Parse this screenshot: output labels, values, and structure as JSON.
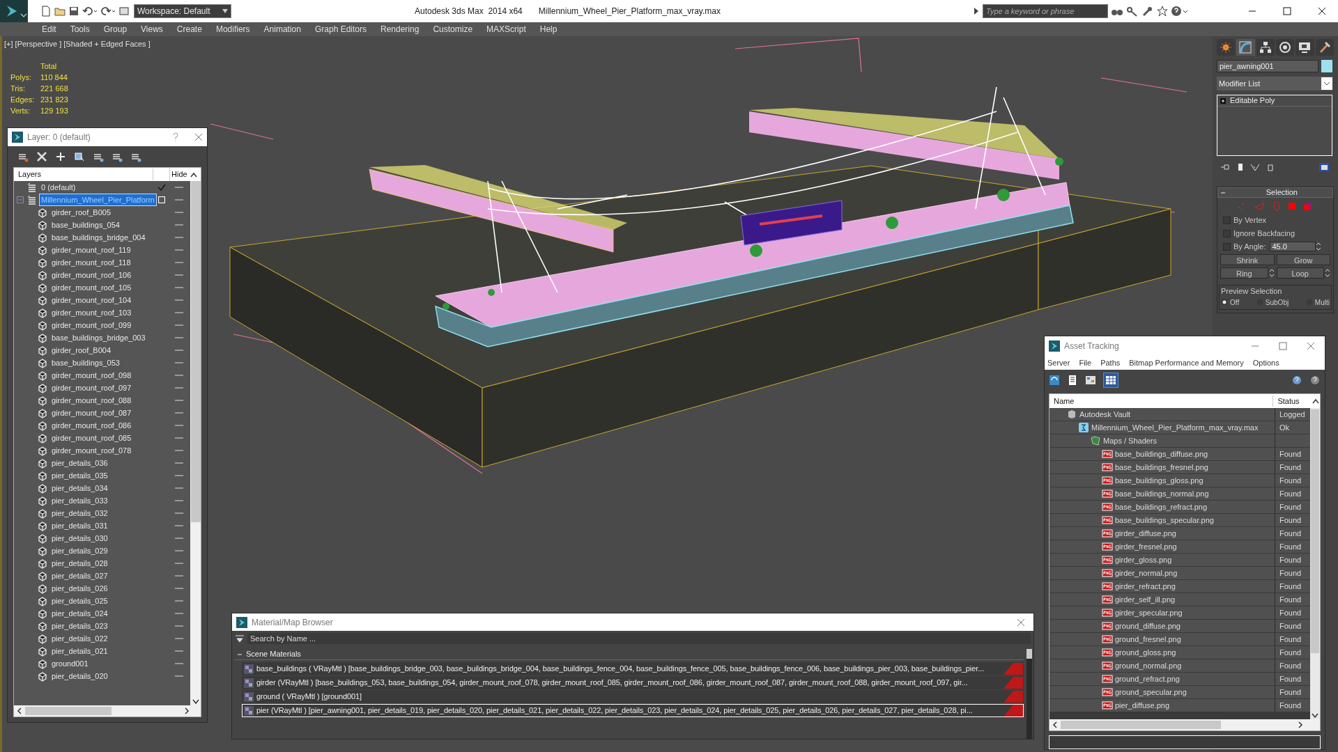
{
  "title_bar": {
    "workspace": "Workspace: Default",
    "app_title": "Autodesk 3ds Max  2014 x64",
    "file_name": "Millennium_Wheel_Pier_Platform_max_vray.max",
    "search": {
      "placeholder": "Type a keyword or phrase"
    }
  },
  "menu": [
    "Edit",
    "Tools",
    "Group",
    "Views",
    "Create",
    "Modifiers",
    "Animation",
    "Graph Editors",
    "Rendering",
    "Customize",
    "MAXScript",
    "Help"
  ],
  "viewport": {
    "label": "[+] [Perspective ] [Shaded + Edged Faces ]",
    "stats": {
      "header": "Total",
      "rows": [
        {
          "label": "Polys:",
          "value": "110 844"
        },
        {
          "label": "Tris:",
          "value": "221 668"
        },
        {
          "label": "Edges:",
          "value": "231 823"
        },
        {
          "label": "Verts:",
          "value": "129 193"
        }
      ]
    }
  },
  "layer_window": {
    "title": "Layer: 0 (default)",
    "columns": [
      "Layers",
      "Hide"
    ],
    "layers": [
      {
        "name": "0 (default)",
        "current": true,
        "selected": false
      },
      {
        "name": "Millennium_Wheel_Pier_Platform",
        "current": false,
        "selected": true,
        "expanded": true,
        "children": [
          {
            "name": "girder_roof_B005",
            "selected": false
          },
          {
            "name": "base_buildings_054",
            "selected": false
          },
          {
            "name": "base_buildings_bridge_004",
            "selected": false
          },
          {
            "name": "girder_mount_roof_119",
            "selected": false
          },
          {
            "name": "girder_mount_roof_118",
            "selected": false
          },
          {
            "name": "girder_mount_roof_106",
            "selected": false
          },
          {
            "name": "girder_mount_roof_105",
            "selected": false
          },
          {
            "name": "girder_mount_roof_104",
            "selected": false
          },
          {
            "name": "girder_mount_roof_103",
            "selected": false
          },
          {
            "name": "girder_mount_roof_099",
            "selected": false
          },
          {
            "name": "base_buildings_bridge_003",
            "selected": false
          },
          {
            "name": "girder_roof_B004",
            "selected": false
          },
          {
            "name": "base_buildings_053",
            "selected": false
          },
          {
            "name": "girder_mount_roof_098",
            "selected": false
          },
          {
            "name": "girder_mount_roof_097",
            "selected": false
          },
          {
            "name": "girder_mount_roof_088",
            "selected": false
          },
          {
            "name": "girder_mount_roof_087",
            "selected": false
          },
          {
            "name": "girder_mount_roof_086",
            "selected": false
          },
          {
            "name": "girder_mount_roof_085",
            "selected": false
          },
          {
            "name": "girder_mount_roof_078",
            "selected": false
          },
          {
            "name": "pier_details_036",
            "selected": false
          },
          {
            "name": "pier_details_035",
            "selected": false
          },
          {
            "name": "pier_details_034",
            "selected": false
          },
          {
            "name": "pier_details_033",
            "selected": false
          },
          {
            "name": "pier_details_032",
            "selected": false
          },
          {
            "name": "pier_details_031",
            "selected": false
          },
          {
            "name": "pier_details_030",
            "selected": false
          },
          {
            "name": "pier_details_029",
            "selected": false
          },
          {
            "name": "pier_details_028",
            "selected": false
          },
          {
            "name": "pier_details_027",
            "selected": false
          },
          {
            "name": "pier_details_026",
            "selected": false
          },
          {
            "name": "pier_details_025",
            "selected": false
          },
          {
            "name": "pier_details_024",
            "selected": false
          },
          {
            "name": "pier_details_023",
            "selected": false
          },
          {
            "name": "pier_details_022",
            "selected": false
          },
          {
            "name": "pier_details_021",
            "selected": false
          },
          {
            "name": "ground001",
            "selected": false
          },
          {
            "name": "pier_details_020",
            "selected": false
          }
        ]
      }
    ]
  },
  "material_browser": {
    "title": "Material/Map Browser",
    "search": {
      "placeholder": "Search by Name ..."
    },
    "group": {
      "label": "Scene Materials",
      "expanded": true
    },
    "materials": [
      {
        "text": "base_buildings ( VRayMtl ) [base_buildings_bridge_003, base_buildings_bridge_004, base_buildings_fence_004, base_buildings_fence_005, base_buildings_fence_006, base_buildings_pier_003, base_buildings_pier...",
        "selected": false
      },
      {
        "text": "girder (VRayMtl ) [base_buildings_053, base_buildings_054, girder_mount_roof_078, girder_mount_roof_085, girder_mount_roof_086, girder_mount_roof_087, girder_mount_roof_088, girder_mount_roof_097, gir...",
        "selected": false
      },
      {
        "text": "ground  ( VRayMtl ) [ground001]",
        "selected": false
      },
      {
        "text": "pier (VRayMtl ) [pier_awning001, pier_details_019, pier_details_020, pier_details_021, pier_details_022, pier_details_023, pier_details_024, pier_details_025, pier_details_026, pier_details_027, pier_details_028, pi...",
        "selected": true
      }
    ]
  },
  "asset_tracking": {
    "title": "Asset Tracking",
    "menu": [
      "Server",
      "File",
      "Paths",
      "Bitmap Performance and Memory",
      "Options"
    ],
    "columns": [
      "Name",
      "Status"
    ],
    "tree": [
      {
        "name": "Autodesk Vault",
        "status": "Logged",
        "kind": "vault",
        "children": [
          {
            "name": "Millennium_Wheel_Pier_Platform_max_vray.max",
            "status": "Ok",
            "kind": "scene",
            "children": [
              {
                "name": "Maps / Shaders",
                "kind": "folder",
                "children": [
                  {
                    "name": "base_buildings_diffuse.png",
                    "status": "Found",
                    "kind": "bitmap"
                  },
                  {
                    "name": "base_buildings_fresnel.png",
                    "status": "Found",
                    "kind": "bitmap"
                  },
                  {
                    "name": "base_buildings_gloss.png",
                    "status": "Found",
                    "kind": "bitmap"
                  },
                  {
                    "name": "base_buildings_normal.png",
                    "status": "Found",
                    "kind": "bitmap"
                  },
                  {
                    "name": "base_buildings_refract.png",
                    "status": "Found",
                    "kind": "bitmap"
                  },
                  {
                    "name": "base_buildings_specular.png",
                    "status": "Found",
                    "kind": "bitmap"
                  },
                  {
                    "name": "girder_diffuse.png",
                    "status": "Found",
                    "kind": "bitmap"
                  },
                  {
                    "name": "girder_fresnel.png",
                    "status": "Found",
                    "kind": "bitmap"
                  },
                  {
                    "name": "girder_gloss.png",
                    "status": "Found",
                    "kind": "bitmap"
                  },
                  {
                    "name": "girder_normal.png",
                    "status": "Found",
                    "kind": "bitmap"
                  },
                  {
                    "name": "girder_refract.png",
                    "status": "Found",
                    "kind": "bitmap"
                  },
                  {
                    "name": "girder_self_ill.png",
                    "status": "Found",
                    "kind": "bitmap"
                  },
                  {
                    "name": "girder_specular.png",
                    "status": "Found",
                    "kind": "bitmap"
                  },
                  {
                    "name": "ground_diffuse.png",
                    "status": "Found",
                    "kind": "bitmap"
                  },
                  {
                    "name": "ground_fresnel.png",
                    "status": "Found",
                    "kind": "bitmap"
                  },
                  {
                    "name": "ground_gloss.png",
                    "status": "Found",
                    "kind": "bitmap"
                  },
                  {
                    "name": "ground_normal.png",
                    "status": "Found",
                    "kind": "bitmap"
                  },
                  {
                    "name": "ground_refract.png",
                    "status": "Found",
                    "kind": "bitmap"
                  },
                  {
                    "name": "ground_specular.png",
                    "status": "Found",
                    "kind": "bitmap"
                  },
                  {
                    "name": "pier_diffuse.png",
                    "status": "Found",
                    "kind": "bitmap"
                  }
                ]
              }
            ]
          }
        ]
      }
    ]
  },
  "command_panel": {
    "tabs": [
      {
        "selected": false
      },
      {
        "selected": true
      },
      {
        "selected": false
      },
      {
        "selected": false
      },
      {
        "selected": false
      },
      {
        "selected": false
      }
    ],
    "object_name": "pier_awning001",
    "modifier_list": "Modifier List",
    "stack": [
      {
        "name": "Editable Poly",
        "expanded": false
      }
    ],
    "selection": {
      "title": "Selection",
      "options": [
        {
          "label": "By Vertex",
          "checked": false
        },
        {
          "label": "Ignore Backfacing",
          "checked": false
        },
        {
          "label": "By Angle:",
          "checked": false
        }
      ],
      "angle": "45.0",
      "buttons": [
        "Shrink",
        "Grow",
        "Ring",
        "Loop"
      ],
      "preview": {
        "label": "Preview Selection",
        "options": [
          {
            "label": "Off",
            "selected": true
          },
          {
            "label": "SubObj",
            "selected": false
          },
          {
            "label": "Multi",
            "selected": false
          }
        ]
      }
    }
  }
}
